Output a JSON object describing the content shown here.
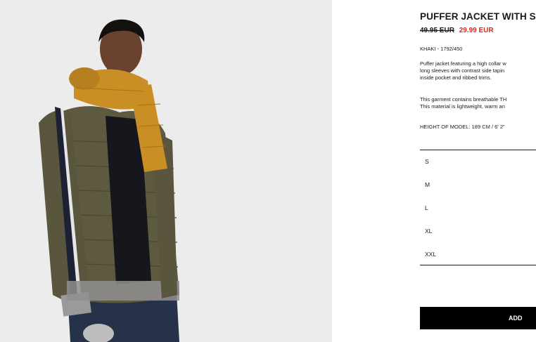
{
  "product": {
    "title": "PUFFER JACKET WITH SIDE",
    "old_price": "49.95 EUR",
    "sale_price": "29.99 EUR",
    "reference": "KHAKI - 1792/450",
    "description_lines": [
      "Puffer jacket featuring a high collar w",
      "long sleeves with contrast side tapin",
      "inside pocket and ribbed trims."
    ],
    "fabric_lines": [
      "This garment contains breathable TH",
      "This material is lightweight, warm an"
    ],
    "model_height": "HEIGHT OF MODEL: 189 CM / 6' 2\""
  },
  "sizes": [
    "S",
    "M",
    "L",
    "XL",
    "XXL"
  ],
  "add_label": "ADD",
  "colors": {
    "sale_red": "#e02525",
    "photo_bg": "#ececec",
    "jacket_khaki": "#5e5a40",
    "scarf_mustard": "#c98f25"
  }
}
